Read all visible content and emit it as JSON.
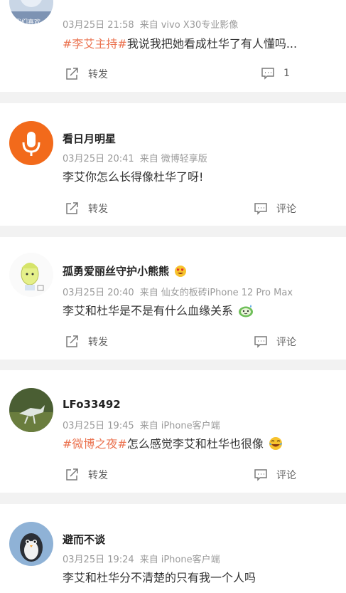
{
  "posts": [
    {
      "avatar_label": "我们喜欢",
      "time": "03月25日 21:58",
      "source_label": "来自",
      "source": "vivo X30专业影像",
      "topic": "#李艾主持#",
      "text": "我说我把她看成杜华了有人懂吗...",
      "repost_label": "转发",
      "comment_count": "1"
    },
    {
      "author": "看日月明星",
      "time": "03月25日 20:41",
      "source_label": "来自",
      "source": "微博轻享版",
      "text": "李艾你怎么长得像杜华了呀!",
      "repost_label": "转发",
      "comment_label": "评论"
    },
    {
      "author": "孤勇爱丽丝守护小熊熊",
      "time": "03月25日 20:40",
      "source_label": "来自",
      "source": "仙女的板砖iPhone 12 Pro Max",
      "text": "李艾和杜华是不是有什么血缘关系",
      "repost_label": "转发",
      "comment_label": "评论"
    },
    {
      "author": "LFo33492",
      "time": "03月25日 19:45",
      "source_label": "来自",
      "source": "iPhone客户端",
      "topic": "#微博之夜#",
      "text": "怎么感觉李艾和杜华也很像",
      "repost_label": "转发",
      "comment_label": "评论"
    },
    {
      "author": "避而不谈",
      "time": "03月25日 19:24",
      "source_label": "来自",
      "source": "iPhone客户端",
      "text": "李艾和杜华分不清楚的只有我一个人吗"
    }
  ],
  "colors": {
    "topic": "#eb7350",
    "meta": "#9a9a9a",
    "background": "#f2f2f2",
    "avatar_orange": "#f26a1b"
  },
  "icons": {
    "repost": "repost-icon",
    "comment": "comment-icon",
    "microphone": "microphone-icon",
    "heart_eyes": "heart-eyes-emoji",
    "sweat": "sweat-emoji",
    "laugh_cry": "laugh-cry-emoji"
  }
}
